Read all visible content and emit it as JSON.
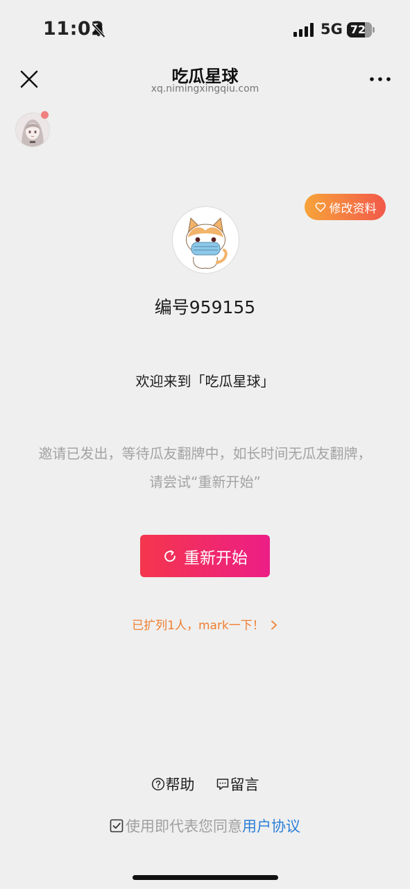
{
  "status_bar": {
    "time": "11:02",
    "network": "5G",
    "battery": "72"
  },
  "nav": {
    "title": "吃瓜星球",
    "domain": "xq.nimingxingqiu.com"
  },
  "profile": {
    "edit_label": "修改资料",
    "user_id": "编号959155"
  },
  "main": {
    "welcome": "欢迎来到「吃瓜星球」",
    "message": "邀请已发出，等待瓜友翻牌中，如长时间无瓜友翻牌，请尝试“重新开始”",
    "restart_label": "重新开始",
    "mark_link": "已扩列1人，mark一下！"
  },
  "footer": {
    "help_label": "帮助",
    "message_label": "留言",
    "agreement_text": "使用即代表您同意",
    "agreement_link": "用户协议"
  },
  "colors": {
    "background": "#efefef",
    "primary_gradient_start": "#f4364d",
    "primary_gradient_end": "#ec1e86",
    "edit_gradient_start": "#f7a43a",
    "edit_gradient_end": "#f2594a",
    "link_orange": "#ef7e2f",
    "link_blue": "#2b7fd8",
    "notify_dot": "#f0807f"
  },
  "icons": [
    "bell-slash-icon",
    "signal-icon",
    "close-icon",
    "more-icon",
    "heart-icon",
    "refresh-icon",
    "chevron-right-icon",
    "help-circle-icon",
    "comment-icon",
    "checkbox-icon"
  ]
}
